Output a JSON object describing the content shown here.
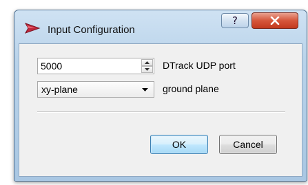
{
  "window": {
    "title": "Input Configuration",
    "help_label": "?",
    "close_label": "X",
    "app_icon": "red-play-icon",
    "colors": {
      "close": "#c8472c",
      "app_icon": "#c0283c",
      "default_button_border": "#3c7fb1"
    }
  },
  "form": {
    "port": {
      "value": "5000",
      "label": "DTrack UDP port"
    },
    "plane": {
      "selected": "xy-plane",
      "label": "ground plane"
    }
  },
  "buttons": {
    "ok": "OK",
    "cancel": "Cancel"
  }
}
